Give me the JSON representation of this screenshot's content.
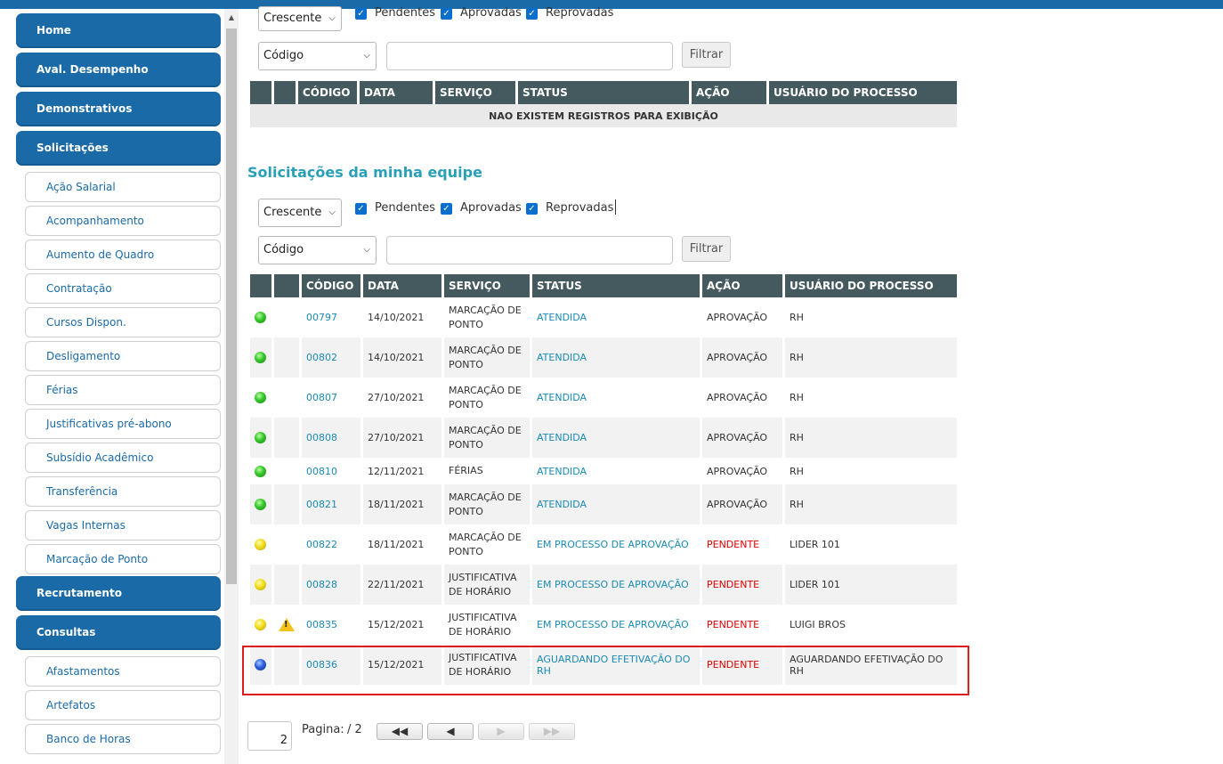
{
  "sidebar": {
    "items": [
      {
        "label": "Home",
        "type": "main"
      },
      {
        "label": "Aval. Desempenho",
        "type": "main"
      },
      {
        "label": "Demonstrativos",
        "type": "main"
      },
      {
        "label": "Solicitações",
        "type": "main"
      },
      {
        "label": "Ação Salarial",
        "type": "sub"
      },
      {
        "label": "Acompanhamento",
        "type": "sub"
      },
      {
        "label": "Aumento de Quadro",
        "type": "sub"
      },
      {
        "label": "Contratação",
        "type": "sub"
      },
      {
        "label": "Cursos Dispon.",
        "type": "sub"
      },
      {
        "label": "Desligamento",
        "type": "sub"
      },
      {
        "label": "Férias",
        "type": "sub"
      },
      {
        "label": "Justificativas pré-abono",
        "type": "sub"
      },
      {
        "label": "Subsídio Acadêmico",
        "type": "sub"
      },
      {
        "label": "Transferência",
        "type": "sub"
      },
      {
        "label": "Vagas Internas",
        "type": "sub"
      },
      {
        "label": "Marcação de Ponto",
        "type": "sub"
      },
      {
        "label": "Recrutamento",
        "type": "main"
      },
      {
        "label": "Consultas",
        "type": "main"
      },
      {
        "label": "Afastamentos",
        "type": "sub"
      },
      {
        "label": "Artefatos",
        "type": "sub"
      },
      {
        "label": "Banco de Horas",
        "type": "sub"
      }
    ]
  },
  "top_filters": {
    "order_select": "Crescente",
    "checkboxes": [
      "Pendentes",
      "Aprovadas",
      "Reprovadas"
    ],
    "field_select": "Código",
    "filter_button": "Filtrar"
  },
  "top_table": {
    "headers": [
      "CÓDIGO",
      "DATA",
      "SERVIÇO",
      "STATUS",
      "AÇÃO",
      "USUÁRIO DO PROCESSO"
    ],
    "empty_message": "NAO EXISTEM REGISTROS PARA EXIBIÇÃO"
  },
  "team_section": {
    "title": "Solicitações da minha equipe",
    "order_select": "Crescente",
    "checkboxes": [
      "Pendentes",
      "Aprovadas",
      "Reprovadas"
    ],
    "field_select": "Código",
    "filter_button": "Filtrar",
    "headers": [
      "CÓDIGO",
      "DATA",
      "SERVIÇO",
      "STATUS",
      "AÇÃO",
      "USUÁRIO DO PROCESSO"
    ],
    "rows": [
      {
        "indicator": "green",
        "warning": false,
        "code": "00797",
        "date": "14/10/2021",
        "service": "MARCAÇÃO DE PONTO",
        "status": "ATENDIDA",
        "action": "APROVAÇÃO",
        "user": "RH"
      },
      {
        "indicator": "green",
        "warning": false,
        "code": "00802",
        "date": "14/10/2021",
        "service": "MARCAÇÃO DE PONTO",
        "status": "ATENDIDA",
        "action": "APROVAÇÃO",
        "user": "RH"
      },
      {
        "indicator": "green",
        "warning": false,
        "code": "00807",
        "date": "27/10/2021",
        "service": "MARCAÇÃO DE PONTO",
        "status": "ATENDIDA",
        "action": "APROVAÇÃO",
        "user": "RH"
      },
      {
        "indicator": "green",
        "warning": false,
        "code": "00808",
        "date": "27/10/2021",
        "service": "MARCAÇÃO DE PONTO",
        "status": "ATENDIDA",
        "action": "APROVAÇÃO",
        "user": "RH"
      },
      {
        "indicator": "green",
        "warning": false,
        "code": "00810",
        "date": "12/11/2021",
        "service": "FÉRIAS",
        "status": "ATENDIDA",
        "action": "APROVAÇÃO",
        "user": "RH"
      },
      {
        "indicator": "green",
        "warning": false,
        "code": "00821",
        "date": "18/11/2021",
        "service": "MARCAÇÃO DE PONTO",
        "status": "ATENDIDA",
        "action": "APROVAÇÃO",
        "user": "RH"
      },
      {
        "indicator": "yellow",
        "warning": false,
        "code": "00822",
        "date": "18/11/2021",
        "service": "MARCAÇÃO DE PONTO",
        "status": "EM PROCESSO DE APROVAÇÃO",
        "action": "PENDENTE",
        "user": "LIDER 101"
      },
      {
        "indicator": "yellow",
        "warning": false,
        "code": "00828",
        "date": "22/11/2021",
        "service": "JUSTIFICATIVA DE HORÁRIO",
        "status": "EM PROCESSO DE APROVAÇÃO",
        "action": "PENDENTE",
        "user": "LIDER 101"
      },
      {
        "indicator": "yellow",
        "warning": true,
        "code": "00835",
        "date": "15/12/2021",
        "service": "JUSTIFICATIVA DE HORÁRIO",
        "status": "EM PROCESSO DE APROVAÇÃO",
        "action": "PENDENTE",
        "user": "LUIGI BROS"
      },
      {
        "indicator": "blue",
        "warning": false,
        "code": "00836",
        "date": "15/12/2021",
        "service": "JUSTIFICATIVA DE HORÁRIO",
        "status": "AGUARDANDO EFETIVAÇÃO DO RH",
        "action": "PENDENTE",
        "user": "AGUARDANDO EFETIVAÇÃO DO RH"
      }
    ]
  },
  "pager": {
    "current_page": "2",
    "label": "Pagina:",
    "total": "/ 2",
    "first": "◀◀",
    "prev": "◀",
    "next": "▶",
    "last": "▶▶"
  },
  "colors": {
    "brand_blue": "#1a6aa8",
    "header_gray": "#455a5f",
    "link_blue": "#1a8ab5",
    "pending_red": "#e00000",
    "title_teal": "#2a9fb8",
    "highlight_red": "#e01b1b"
  }
}
